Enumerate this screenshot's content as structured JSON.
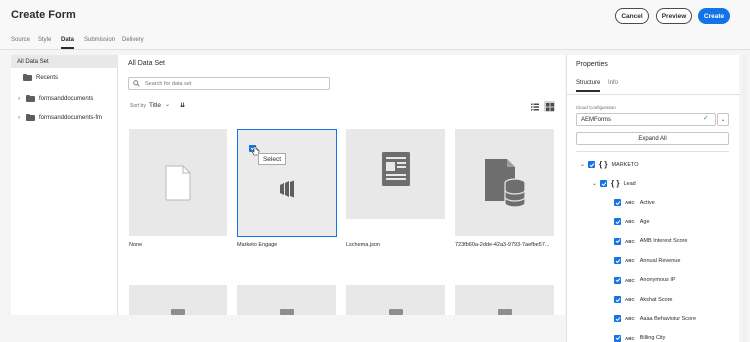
{
  "header": {
    "title": "Create Form",
    "cancel_label": "Cancel",
    "preview_label": "Preview",
    "create_label": "Create"
  },
  "tabs": [
    {
      "label": "Source",
      "active": false
    },
    {
      "label": "Style",
      "active": false
    },
    {
      "label": "Data",
      "active": true
    },
    {
      "label": "Submission",
      "active": false
    },
    {
      "label": "Delivery",
      "active": false
    }
  ],
  "left_nav": {
    "selected": "All Data Set",
    "recents": "Recents",
    "folders": [
      "formsanddocuments",
      "formsanddocuments-fm"
    ]
  },
  "main": {
    "title": "All Data Set",
    "search_placeholder": "Search for data set",
    "sort_by_label": "Sort by",
    "sort_value": "Title",
    "cards": [
      {
        "label": "None",
        "icon": "file-icon"
      },
      {
        "label": "Marketo Engage",
        "icon": "marketo-icon",
        "selected": true,
        "tooltip": "Select"
      },
      {
        "label": "Lschema.json",
        "icon": "document-icon"
      },
      {
        "label": "723fb60a-2dde-42a3-9793-7aefbe57...",
        "icon": "data-file-icon"
      }
    ]
  },
  "properties": {
    "title": "Properties",
    "tabs": [
      {
        "label": "Structure",
        "active": true
      },
      {
        "label": "Info",
        "active": false
      }
    ],
    "cloud_config_label": "Cloud Configuration",
    "cloud_config_value": "AEMForms",
    "expand_all_label": "Expand All",
    "tree": {
      "root": "MARKETO",
      "child": "Lead",
      "fields": [
        "Active",
        "Age",
        "AMB Interest Score",
        "Annual Revenue",
        "Anonymous IP",
        "Akshat Score",
        "Aaaa Behavioiur Score",
        "Billing City"
      ]
    },
    "abc_label": "ABC"
  },
  "colors": {
    "accent": "#1473e6",
    "success": "#2d9d78",
    "card_bg": "#e8e8e8"
  }
}
